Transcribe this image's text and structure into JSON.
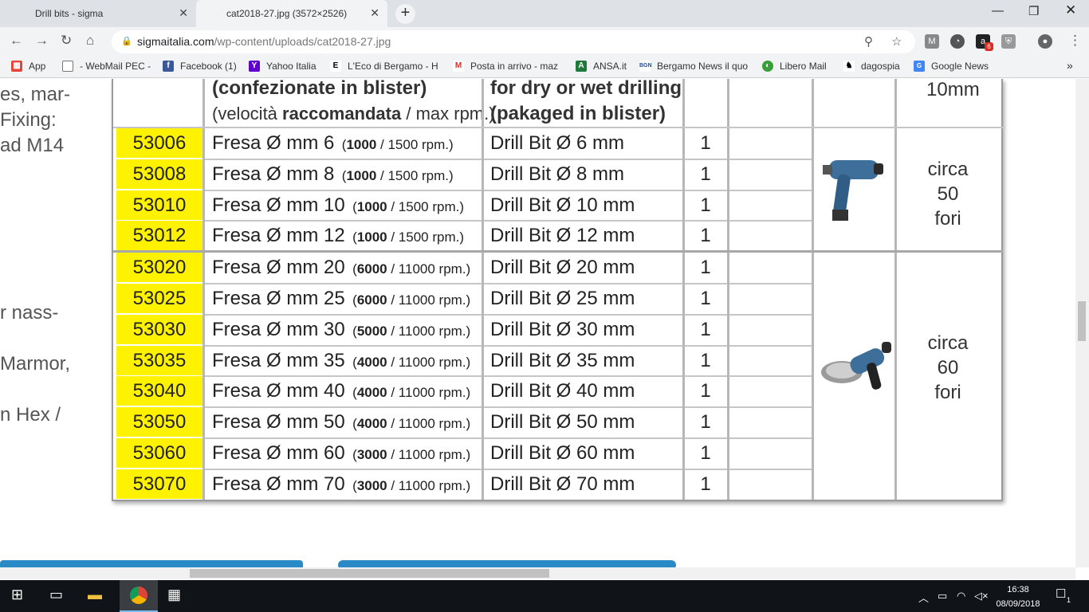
{
  "browser": {
    "tabs": [
      {
        "title": "Drill bits - sigma"
      },
      {
        "title": "cat2018-27.jpg (3572×2526)"
      }
    ],
    "url_host": "sigmaitalia.com",
    "url_path": "/wp-content/uploads/cat2018-27.jpg",
    "bookmarks": [
      {
        "label": "App",
        "icon": "apps-grid-icon"
      },
      {
        "label": "- WebMail PEC -",
        "icon": "page-icon"
      },
      {
        "label": "Facebook (1)",
        "icon": "facebook-icon"
      },
      {
        "label": "Yahoo Italia",
        "icon": "yahoo-icon"
      },
      {
        "label": "L'Eco di Bergamo - H",
        "icon": "eco-icon"
      },
      {
        "label": "Posta in arrivo - maz",
        "icon": "gmail-icon"
      },
      {
        "label": "ANSA.it",
        "icon": "ansa-icon"
      },
      {
        "label": "Bergamo News il quo",
        "icon": "bgn-icon"
      },
      {
        "label": "Libero Mail",
        "icon": "libero-icon"
      },
      {
        "label": "dagospia",
        "icon": "dagospia-icon"
      },
      {
        "label": "Google News",
        "icon": "google-news-icon"
      }
    ],
    "ext_badge": "6"
  },
  "image": {
    "left_text": [
      "es, mar-",
      "Fixing:",
      "ad M14",
      "r nass-",
      "Marmor,",
      "n Hex /"
    ],
    "header": {
      "it_line1": "(confezionate in blister)",
      "it_line2_pre": "(velocità ",
      "it_line2_bold": "raccomandata",
      "it_line2_post": " / max  rpm.)",
      "en_line1": "for dry or wet drilling",
      "en_line2": "(pakaged in blister)",
      "size_label": "10mm"
    },
    "rows": [
      {
        "code": "53006",
        "it": "Fresa Ø mm 6",
        "rpm_rec": "1000",
        "rpm_max": " / 1500 rpm.)",
        "en": "Drill Bit Ø 6 mm",
        "qty": "1"
      },
      {
        "code": "53008",
        "it": "Fresa Ø mm 8",
        "rpm_rec": "1000",
        "rpm_max": " / 1500 rpm.)",
        "en": "Drill Bit Ø 8 mm",
        "qty": "1"
      },
      {
        "code": "53010",
        "it": "Fresa Ø mm 10",
        "rpm_rec": "1000",
        "rpm_max": " / 1500 rpm.)",
        "en": "Drill Bit Ø 10 mm",
        "qty": "1"
      },
      {
        "code": "53012",
        "it": "Fresa Ø mm 12",
        "rpm_rec": "1000",
        "rpm_max": " / 1500 rpm.)",
        "en": "Drill Bit Ø 12 mm",
        "qty": "1"
      },
      {
        "code": "53020",
        "it": "Fresa Ø mm 20",
        "rpm_rec": "6000",
        "rpm_max": " / 11000 rpm.)",
        "en": "Drill Bit Ø 20 mm",
        "qty": "1"
      },
      {
        "code": "53025",
        "it": "Fresa Ø mm 25",
        "rpm_rec": "6000",
        "rpm_max": " / 11000 rpm.)",
        "en": "Drill Bit Ø 25 mm",
        "qty": "1"
      },
      {
        "code": "53030",
        "it": "Fresa Ø mm 30",
        "rpm_rec": "5000",
        "rpm_max": " / 11000 rpm.)",
        "en": "Drill Bit Ø 30 mm",
        "qty": "1"
      },
      {
        "code": "53035",
        "it": "Fresa Ø mm 35",
        "rpm_rec": "4000",
        "rpm_max": " / 11000 rpm.)",
        "en": "Drill Bit Ø 35 mm",
        "qty": "1"
      },
      {
        "code": "53040",
        "it": "Fresa Ø mm 40",
        "rpm_rec": "4000",
        "rpm_max": " / 11000 rpm.)",
        "en": "Drill Bit Ø 40 mm",
        "qty": "1"
      },
      {
        "code": "53050",
        "it": "Fresa Ø mm 50",
        "rpm_rec": "4000",
        "rpm_max": " / 11000 rpm.)",
        "en": "Drill Bit Ø 50 mm",
        "qty": "1"
      },
      {
        "code": "53060",
        "it": "Fresa Ø mm 60",
        "rpm_rec": "3000",
        "rpm_max": " / 11000 rpm.)",
        "en": "Drill Bit Ø 60 mm",
        "qty": "1"
      },
      {
        "code": "53070",
        "it": "Fresa Ø mm 70",
        "rpm_rec": "3000",
        "rpm_max": " / 11000 rpm.)",
        "en": "Drill Bit Ø 70 mm",
        "qty": "1"
      }
    ],
    "group1_note": [
      "circa",
      "50",
      "fori"
    ],
    "group2_note": [
      "circa",
      "60",
      "fori"
    ]
  },
  "taskbar": {
    "time": "16:38",
    "date": "08/09/2018",
    "notif_count": "1"
  },
  "colors": {
    "code_bg": "#fff200",
    "taskbar": "#101317"
  }
}
